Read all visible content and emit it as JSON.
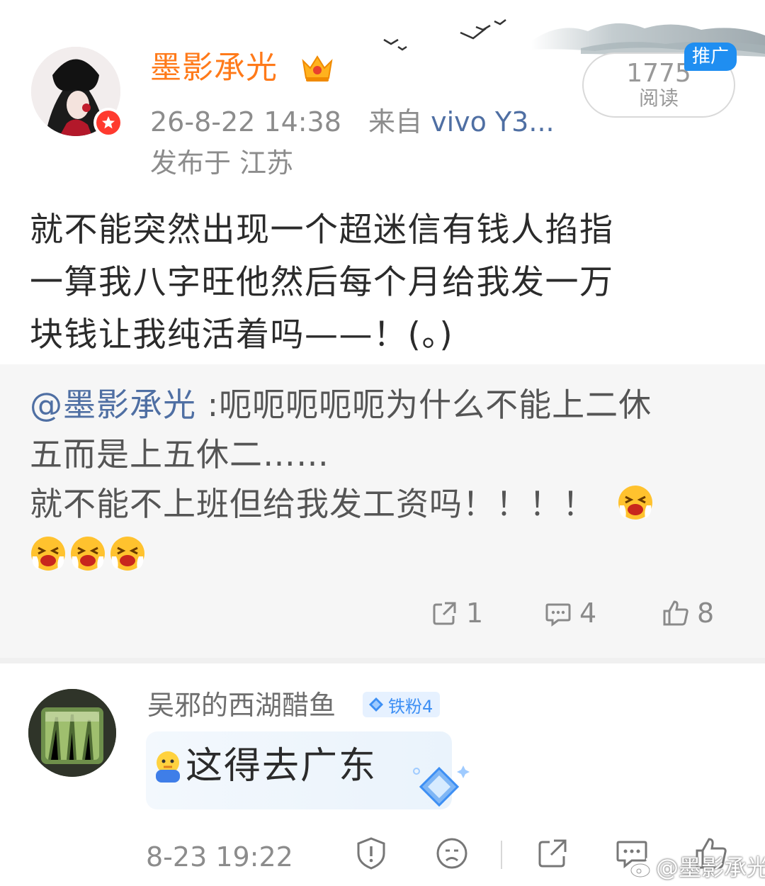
{
  "post": {
    "author": "墨影承光",
    "datetime": "26-8-22 14:38",
    "source_prefix": "来自",
    "source": "vivo Y3...",
    "location": "发布于 江苏",
    "read_count": "1775",
    "read_label": "阅读",
    "promo_tag": "推广",
    "text_lines": [
      "就不能突然出现一个超迷信有钱人掐指",
      "一算我八字旺他然后每个月给我发一万",
      "块钱让我纯活着吗——！(。)"
    ]
  },
  "quote": {
    "mention": "@墨影承光",
    "line1": " :呃呃呃呃呃为什么不能上二休",
    "line2": "五而是上五休二……",
    "line3": "就不能不上班但给我发工资吗！！！！",
    "emoji_name": "crying-emoji",
    "repost_count": "1",
    "comment_count": "4",
    "like_count": "8"
  },
  "comment": {
    "author": "吴邪的西湖醋鱼",
    "fan_badge": "铁粉4",
    "text": "这得去广东",
    "time": "8-23 19:22"
  },
  "watermark": "@墨影承光",
  "colors": {
    "author_orange": "#ff7a1a",
    "link_blue": "#4f6fa3",
    "promo_blue": "#1f8ef1",
    "badge_red": "#ff3a2f"
  }
}
